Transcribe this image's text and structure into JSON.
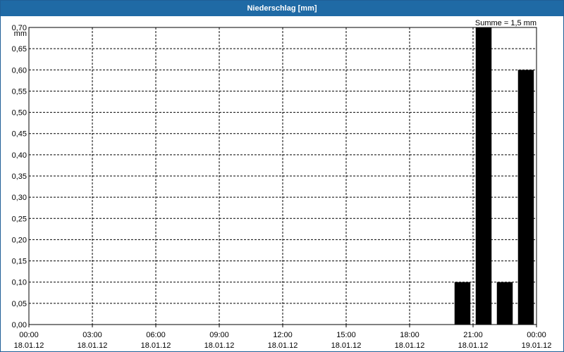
{
  "window": {
    "title": "Niederschlag [mm]"
  },
  "chart_data": {
    "type": "bar",
    "title": "Niederschlag [mm]",
    "ylabel": "mm",
    "annotation": "Summe = 1,5 mm",
    "ylim": [
      0,
      0.7
    ],
    "ytick_labels": [
      "0,00",
      "0,05",
      "0,10",
      "0,15",
      "0,20",
      "0,25",
      "0,30",
      "0,35",
      "0,40",
      "0,45",
      "0,50",
      "0,55",
      "0,60",
      "0,65",
      "0,70"
    ],
    "x_start": "2012-01-18T00:00",
    "x_end": "2012-01-19T00:00",
    "xticks": [
      {
        "time": "00:00",
        "date": "18.01.12"
      },
      {
        "time": "03:00",
        "date": "18.01.12"
      },
      {
        "time": "06:00",
        "date": "18.01.12"
      },
      {
        "time": "09:00",
        "date": "18.01.12"
      },
      {
        "time": "12:00",
        "date": "18.01.12"
      },
      {
        "time": "15:00",
        "date": "18.01.12"
      },
      {
        "time": "18:00",
        "date": "18.01.12"
      },
      {
        "time": "21:00",
        "date": "18.01.12"
      },
      {
        "time": "00:00",
        "date": "19.01.12"
      }
    ],
    "bars": [
      {
        "x": "2012-01-18T20:30",
        "value": 0.1
      },
      {
        "x": "2012-01-18T21:30",
        "value": 0.7
      },
      {
        "x": "2012-01-18T22:30",
        "value": 0.1
      },
      {
        "x": "2012-01-18T23:30",
        "value": 0.6
      }
    ],
    "grid": true,
    "bar_color": "#000000"
  }
}
